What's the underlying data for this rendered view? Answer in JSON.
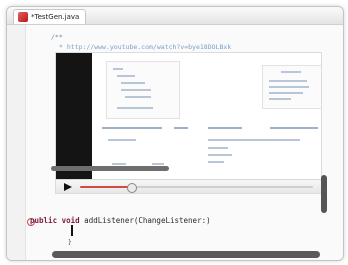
{
  "window": {
    "tab_title": "*TestGen.java"
  },
  "editor": {
    "comment_open": "/**",
    "url_line": "* http://www.youtube.com/watch?v=bye18DOLBxk",
    "method_signature": {
      "keywords": "public void",
      "rest": " addListener(ChangeListener:)"
    },
    "closing": "}"
  },
  "video": {
    "progress_percent": 23,
    "thumb_position_percent": 22
  },
  "colors": {
    "progress": "#d04b43",
    "keyword": "#7b1b3f",
    "comment": "#6a8ab8"
  }
}
